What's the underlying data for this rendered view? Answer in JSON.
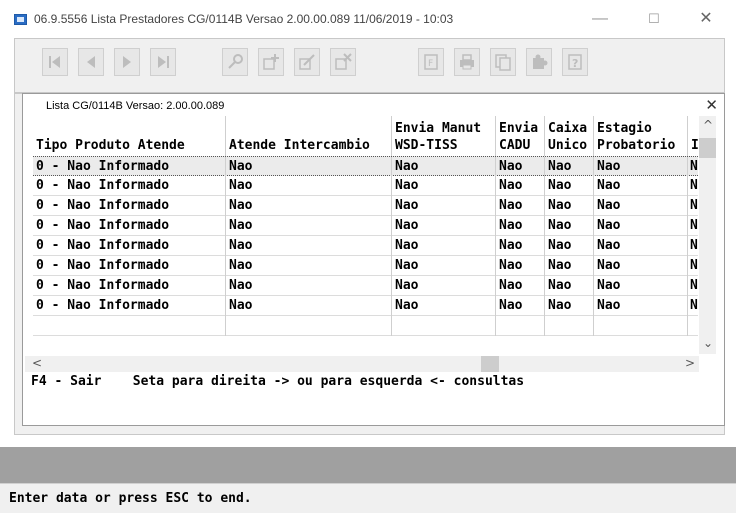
{
  "window": {
    "title": "06.9.5556   Lista  Prestadores CG/0114B Versao 2.00.00.089 11/06/2019 - 10:03",
    "minimize": "—",
    "maximize": "☐",
    "close": "✕"
  },
  "toolbar": {
    "buttons": [
      {
        "name": "first-record-button",
        "icon": "first-icon"
      },
      {
        "name": "previous-record-button",
        "icon": "previous-icon"
      },
      {
        "name": "next-record-button",
        "icon": "next-icon"
      },
      {
        "name": "last-record-button",
        "icon": "last-icon"
      },
      {
        "name": "search-button",
        "icon": "key-icon"
      },
      {
        "name": "add-button",
        "icon": "add-icon"
      },
      {
        "name": "edit-button",
        "icon": "edit-icon"
      },
      {
        "name": "delete-button",
        "icon": "delete-icon"
      },
      {
        "name": "filter-button",
        "icon": "filter-icon"
      },
      {
        "name": "print-button",
        "icon": "printer-icon"
      },
      {
        "name": "copy-button",
        "icon": "copy-icon"
      },
      {
        "name": "help-button",
        "icon": "question-icon"
      }
    ]
  },
  "dialog": {
    "title": "Lista CG/0114B Versao: 2.00.00.089",
    "close": "✕",
    "columns": [
      {
        "line1": "",
        "line2": "Tipo Produto Atende"
      },
      {
        "line1": "",
        "line2": "Atende Intercambio"
      },
      {
        "line1": "Envia Manut",
        "line2": "WSD-TISS"
      },
      {
        "line1": "Envia",
        "line2": "CADU"
      },
      {
        "line1": "Caixa",
        "line2": "Unico"
      },
      {
        "line1": "Estagio",
        "line2": "Probatorio"
      },
      {
        "line1": "",
        "line2": "I"
      }
    ],
    "rows": [
      [
        "0 - Nao Informado",
        "Nao",
        "Nao",
        "Nao",
        "Nao",
        "Nao",
        "N"
      ],
      [
        "0 - Nao Informado",
        "Nao",
        "Nao",
        "Nao",
        "Nao",
        "Nao",
        "N"
      ],
      [
        "0 - Nao Informado",
        "Nao",
        "Nao",
        "Nao",
        "Nao",
        "Nao",
        "N"
      ],
      [
        "0 - Nao Informado",
        "Nao",
        "Nao",
        "Nao",
        "Nao",
        "Nao",
        "N"
      ],
      [
        "0 - Nao Informado",
        "Nao",
        "Nao",
        "Nao",
        "Nao",
        "Nao",
        "N"
      ],
      [
        "0 - Nao Informado",
        "Nao",
        "Nao",
        "Nao",
        "Nao",
        "Nao",
        "N"
      ],
      [
        "0 - Nao Informado",
        "Nao",
        "Nao",
        "Nao",
        "Nao",
        "Nao",
        "N"
      ],
      [
        "0 - Nao Informado",
        "Nao",
        "Nao",
        "Nao",
        "Nao",
        "Nao",
        "N"
      ],
      [
        "",
        "",
        "",
        "",
        "",
        "",
        ""
      ]
    ],
    "selected_row": 0,
    "help_line": "F4 - Sair    Seta para direita -> ou para esquerda <- consultas"
  },
  "status": {
    "message": "Enter data or press ESC to end."
  }
}
